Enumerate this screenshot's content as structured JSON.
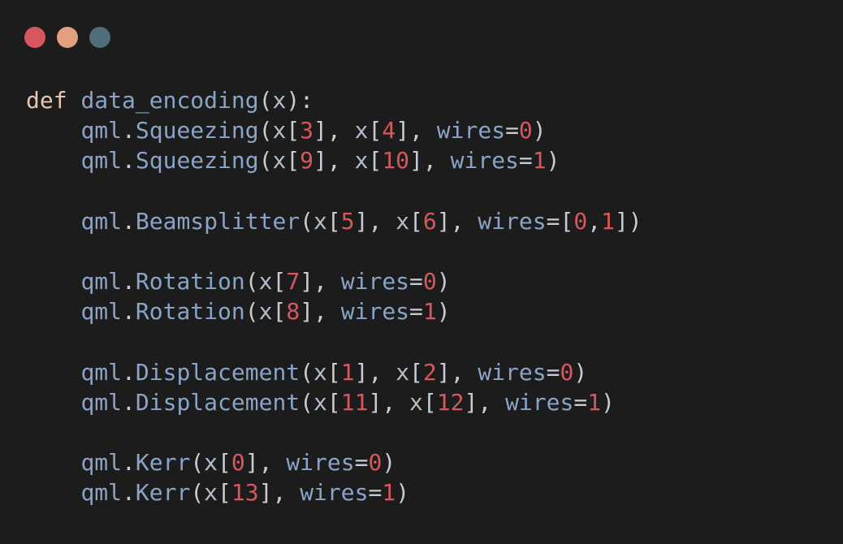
{
  "colors": {
    "background": "#1c1c1c",
    "dot_red": "#d7575e",
    "dot_peach": "#e4a07e",
    "dot_teal": "#4f6e79",
    "keyword": "#e8c6b2",
    "name": "#8aa4c8",
    "punctuation": "#c5ccd6",
    "number": "#d7575e"
  },
  "window_controls": [
    {
      "name": "close-dot",
      "color": "#d7575e"
    },
    {
      "name": "minimize-dot",
      "color": "#e4a07e"
    },
    {
      "name": "maximize-dot",
      "color": "#4f6e79"
    }
  ],
  "code_lines": [
    [
      {
        "t": "def",
        "c": "kw"
      },
      {
        "t": " ",
        "c": "punct"
      },
      {
        "t": "data_encoding",
        "c": "fn"
      },
      {
        "t": "(",
        "c": "punct"
      },
      {
        "t": "x",
        "c": "var"
      },
      {
        "t": "):",
        "c": "punct"
      }
    ],
    [
      {
        "t": "    ",
        "c": "punct"
      },
      {
        "t": "qml",
        "c": "fn"
      },
      {
        "t": ".",
        "c": "punct"
      },
      {
        "t": "Squeezing",
        "c": "fn"
      },
      {
        "t": "(",
        "c": "punct"
      },
      {
        "t": "x",
        "c": "var"
      },
      {
        "t": "[",
        "c": "punct"
      },
      {
        "t": "3",
        "c": "num"
      },
      {
        "t": "], ",
        "c": "punct"
      },
      {
        "t": "x",
        "c": "var"
      },
      {
        "t": "[",
        "c": "punct"
      },
      {
        "t": "4",
        "c": "num"
      },
      {
        "t": "], ",
        "c": "punct"
      },
      {
        "t": "wires",
        "c": "kwarg"
      },
      {
        "t": "=",
        "c": "punct"
      },
      {
        "t": "0",
        "c": "num"
      },
      {
        "t": ")",
        "c": "punct"
      }
    ],
    [
      {
        "t": "    ",
        "c": "punct"
      },
      {
        "t": "qml",
        "c": "fn"
      },
      {
        "t": ".",
        "c": "punct"
      },
      {
        "t": "Squeezing",
        "c": "fn"
      },
      {
        "t": "(",
        "c": "punct"
      },
      {
        "t": "x",
        "c": "var"
      },
      {
        "t": "[",
        "c": "punct"
      },
      {
        "t": "9",
        "c": "num"
      },
      {
        "t": "], ",
        "c": "punct"
      },
      {
        "t": "x",
        "c": "var"
      },
      {
        "t": "[",
        "c": "punct"
      },
      {
        "t": "10",
        "c": "num"
      },
      {
        "t": "], ",
        "c": "punct"
      },
      {
        "t": "wires",
        "c": "kwarg"
      },
      {
        "t": "=",
        "c": "punct"
      },
      {
        "t": "1",
        "c": "num"
      },
      {
        "t": ")",
        "c": "punct"
      }
    ],
    [],
    [
      {
        "t": "    ",
        "c": "punct"
      },
      {
        "t": "qml",
        "c": "fn"
      },
      {
        "t": ".",
        "c": "punct"
      },
      {
        "t": "Beamsplitter",
        "c": "fn"
      },
      {
        "t": "(",
        "c": "punct"
      },
      {
        "t": "x",
        "c": "var"
      },
      {
        "t": "[",
        "c": "punct"
      },
      {
        "t": "5",
        "c": "num"
      },
      {
        "t": "], ",
        "c": "punct"
      },
      {
        "t": "x",
        "c": "var"
      },
      {
        "t": "[",
        "c": "punct"
      },
      {
        "t": "6",
        "c": "num"
      },
      {
        "t": "], ",
        "c": "punct"
      },
      {
        "t": "wires",
        "c": "kwarg"
      },
      {
        "t": "=[",
        "c": "punct"
      },
      {
        "t": "0",
        "c": "num"
      },
      {
        "t": ",",
        "c": "punct"
      },
      {
        "t": "1",
        "c": "num"
      },
      {
        "t": "])",
        "c": "punct"
      }
    ],
    [],
    [
      {
        "t": "    ",
        "c": "punct"
      },
      {
        "t": "qml",
        "c": "fn"
      },
      {
        "t": ".",
        "c": "punct"
      },
      {
        "t": "Rotation",
        "c": "fn"
      },
      {
        "t": "(",
        "c": "punct"
      },
      {
        "t": "x",
        "c": "var"
      },
      {
        "t": "[",
        "c": "punct"
      },
      {
        "t": "7",
        "c": "num"
      },
      {
        "t": "], ",
        "c": "punct"
      },
      {
        "t": "wires",
        "c": "kwarg"
      },
      {
        "t": "=",
        "c": "punct"
      },
      {
        "t": "0",
        "c": "num"
      },
      {
        "t": ")",
        "c": "punct"
      }
    ],
    [
      {
        "t": "    ",
        "c": "punct"
      },
      {
        "t": "qml",
        "c": "fn"
      },
      {
        "t": ".",
        "c": "punct"
      },
      {
        "t": "Rotation",
        "c": "fn"
      },
      {
        "t": "(",
        "c": "punct"
      },
      {
        "t": "x",
        "c": "var"
      },
      {
        "t": "[",
        "c": "punct"
      },
      {
        "t": "8",
        "c": "num"
      },
      {
        "t": "], ",
        "c": "punct"
      },
      {
        "t": "wires",
        "c": "kwarg"
      },
      {
        "t": "=",
        "c": "punct"
      },
      {
        "t": "1",
        "c": "num"
      },
      {
        "t": ")",
        "c": "punct"
      }
    ],
    [],
    [
      {
        "t": "    ",
        "c": "punct"
      },
      {
        "t": "qml",
        "c": "fn"
      },
      {
        "t": ".",
        "c": "punct"
      },
      {
        "t": "Displacement",
        "c": "fn"
      },
      {
        "t": "(",
        "c": "punct"
      },
      {
        "t": "x",
        "c": "var"
      },
      {
        "t": "[",
        "c": "punct"
      },
      {
        "t": "1",
        "c": "num"
      },
      {
        "t": "], ",
        "c": "punct"
      },
      {
        "t": "x",
        "c": "var"
      },
      {
        "t": "[",
        "c": "punct"
      },
      {
        "t": "2",
        "c": "num"
      },
      {
        "t": "], ",
        "c": "punct"
      },
      {
        "t": "wires",
        "c": "kwarg"
      },
      {
        "t": "=",
        "c": "punct"
      },
      {
        "t": "0",
        "c": "num"
      },
      {
        "t": ")",
        "c": "punct"
      }
    ],
    [
      {
        "t": "    ",
        "c": "punct"
      },
      {
        "t": "qml",
        "c": "fn"
      },
      {
        "t": ".",
        "c": "punct"
      },
      {
        "t": "Displacement",
        "c": "fn"
      },
      {
        "t": "(",
        "c": "punct"
      },
      {
        "t": "x",
        "c": "var"
      },
      {
        "t": "[",
        "c": "punct"
      },
      {
        "t": "11",
        "c": "num"
      },
      {
        "t": "], ",
        "c": "punct"
      },
      {
        "t": "x",
        "c": "var"
      },
      {
        "t": "[",
        "c": "punct"
      },
      {
        "t": "12",
        "c": "num"
      },
      {
        "t": "], ",
        "c": "punct"
      },
      {
        "t": "wires",
        "c": "kwarg"
      },
      {
        "t": "=",
        "c": "punct"
      },
      {
        "t": "1",
        "c": "num"
      },
      {
        "t": ")",
        "c": "punct"
      }
    ],
    [],
    [
      {
        "t": "    ",
        "c": "punct"
      },
      {
        "t": "qml",
        "c": "fn"
      },
      {
        "t": ".",
        "c": "punct"
      },
      {
        "t": "Kerr",
        "c": "fn"
      },
      {
        "t": "(",
        "c": "punct"
      },
      {
        "t": "x",
        "c": "var"
      },
      {
        "t": "[",
        "c": "punct"
      },
      {
        "t": "0",
        "c": "num"
      },
      {
        "t": "], ",
        "c": "punct"
      },
      {
        "t": "wires",
        "c": "kwarg"
      },
      {
        "t": "=",
        "c": "punct"
      },
      {
        "t": "0",
        "c": "num"
      },
      {
        "t": ")",
        "c": "punct"
      }
    ],
    [
      {
        "t": "    ",
        "c": "punct"
      },
      {
        "t": "qml",
        "c": "fn"
      },
      {
        "t": ".",
        "c": "punct"
      },
      {
        "t": "Kerr",
        "c": "fn"
      },
      {
        "t": "(",
        "c": "punct"
      },
      {
        "t": "x",
        "c": "var"
      },
      {
        "t": "[",
        "c": "punct"
      },
      {
        "t": "13",
        "c": "num"
      },
      {
        "t": "], ",
        "c": "punct"
      },
      {
        "t": "wires",
        "c": "kwarg"
      },
      {
        "t": "=",
        "c": "punct"
      },
      {
        "t": "1",
        "c": "num"
      },
      {
        "t": ")",
        "c": "punct"
      }
    ]
  ]
}
